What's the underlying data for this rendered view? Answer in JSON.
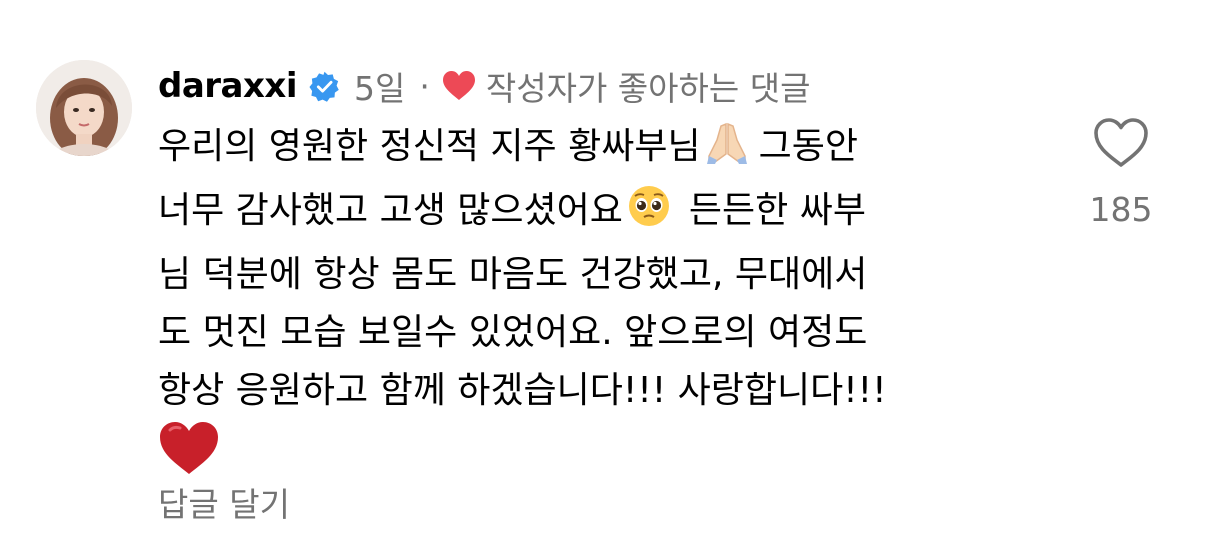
{
  "comment": {
    "username": "daraxxi",
    "time": "5일",
    "separator": "·",
    "creator_liked_label": "작성자가 좋아하는 댓글",
    "lines": [
      "우리의 영원한 정신적 지주 황싸부님",
      "그동안",
      "너무 감사했고 고생 많으셨어요",
      "든든한 싸부",
      "님 덕분에 항상 몸도 마음도 건강했고, 무대에서",
      "도 멋진 모습 보일수 있었어요. 앞으로의 여정도",
      "항상 응원하고 함께 하겠습니다!!! 사랑합니다!!!"
    ],
    "emojis": [
      "folded-hands",
      "pleading-face",
      "red-heart"
    ],
    "reply_label": "답글 달기",
    "like_count": "185"
  },
  "colors": {
    "text": "#000000",
    "secondary": "#737373",
    "verified_blue": "#3897F0",
    "heart_red": "#ED4956"
  },
  "icons": [
    "verified-badge-icon",
    "heart-icon",
    "like-outline-icon"
  ]
}
